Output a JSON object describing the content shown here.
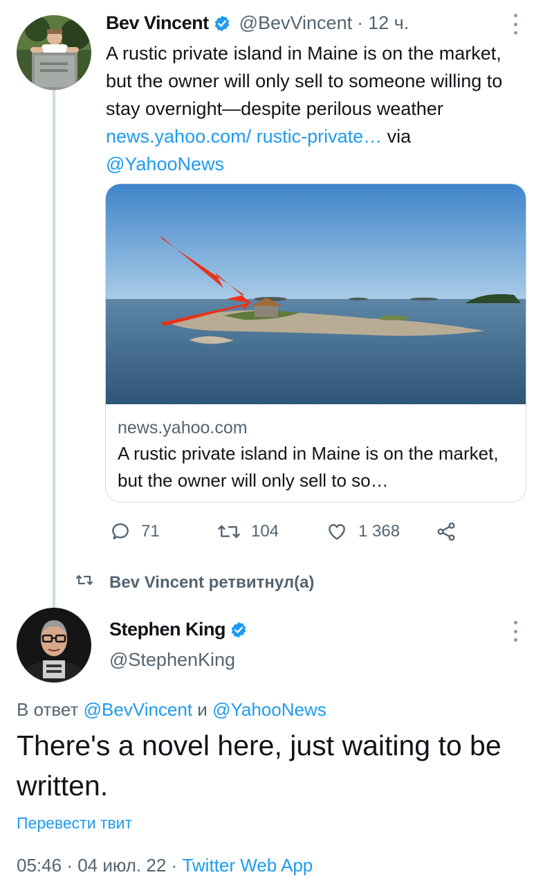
{
  "retweeter_tweet": {
    "name": "Bev Vincent",
    "handle": "@BevVincent",
    "separator": "·",
    "time": "12 ч.",
    "text_before_link": "A rustic private island in Maine is on the market, but the owner will only sell to someone willing to stay overnight—despite perilous weather ",
    "link_text": "news.yahoo.com/ rustic-private…",
    "text_via": " via ",
    "mention": "@YahooNews",
    "card": {
      "domain": "news.yahoo.com",
      "title": "A rustic private island in Maine is on the market, but the owner will only sell to so…"
    },
    "actions": {
      "replies": "71",
      "retweets": "104",
      "likes": "1 368"
    }
  },
  "retweet_indicator": "Bev Vincent ретвитнул(а)",
  "main_tweet": {
    "name": "Stephen King",
    "handle": "@StephenKing",
    "reply_prefix": "В ответ ",
    "reply_user1": "@BevVincent",
    "reply_and": " и ",
    "reply_user2": "@YahooNews",
    "text": "There's a novel here, just waiting to be written.",
    "translate": "Перевести твит",
    "time": "05:46",
    "meta_sep": " · ",
    "date": "04 июл. 22",
    "source": "Twitter Web App"
  },
  "colors": {
    "accent": "#1d9bf0",
    "secondary_text": "#536471",
    "primary_text": "#0f1419",
    "border": "#cfd9de"
  }
}
